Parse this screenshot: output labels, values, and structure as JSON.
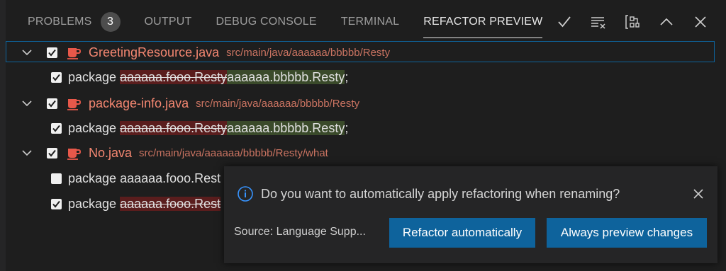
{
  "tabs": [
    {
      "label": "PROBLEMS",
      "badge": "3"
    },
    {
      "label": "OUTPUT"
    },
    {
      "label": "DEBUG CONSOLE"
    },
    {
      "label": "TERMINAL"
    },
    {
      "label": "REFACTOR PREVIEW"
    }
  ],
  "active_tab": "REFACTOR PREVIEW",
  "actions": [
    "check-icon",
    "clear-list-icon",
    "collapse-group-icon",
    "chevron-up-icon",
    "close-icon"
  ],
  "files": [
    {
      "name": "GreetingResource.java",
      "path": "src/main/java/aaaaaa/bbbbb/Resty",
      "checked": true,
      "change": {
        "prefix": "package ",
        "old": "aaaaaa.fooo.Resty",
        "new": "aaaaaa.bbbbb.Resty",
        "suffix": ";",
        "checked": true
      }
    },
    {
      "name": "package-info.java",
      "path": "src/main/java/aaaaaa/bbbbb/Resty",
      "checked": true,
      "change": {
        "prefix": "package ",
        "old": "aaaaaa.fooo.Resty",
        "new": "aaaaaa.bbbbb.Resty",
        "suffix": ";",
        "checked": true
      }
    },
    {
      "name": "No.java",
      "path": "src/main/java/aaaaaa/bbbbb/Resty/what",
      "checked": true,
      "changes": [
        {
          "prefix": "package ",
          "text": "aaaaaa.fooo.Rest",
          "checked": false
        },
        {
          "prefix": "package ",
          "old": "aaaaaa.fooo.Rest",
          "checked": true
        }
      ]
    }
  ],
  "toast": {
    "message": "Do you want to automatically apply refactoring when renaming?",
    "source": "Source: Language Supp...",
    "primary_label": "Refactor automatically",
    "secondary_label": "Always preview changes"
  },
  "colors": {
    "background": "#1e1e1e",
    "filename": "#f48771",
    "path": "#c97361",
    "deleted_bg": "#5a1d1d",
    "inserted_bg": "#3a4a2a",
    "button": "#0e639c",
    "focus": "#0e639c"
  }
}
